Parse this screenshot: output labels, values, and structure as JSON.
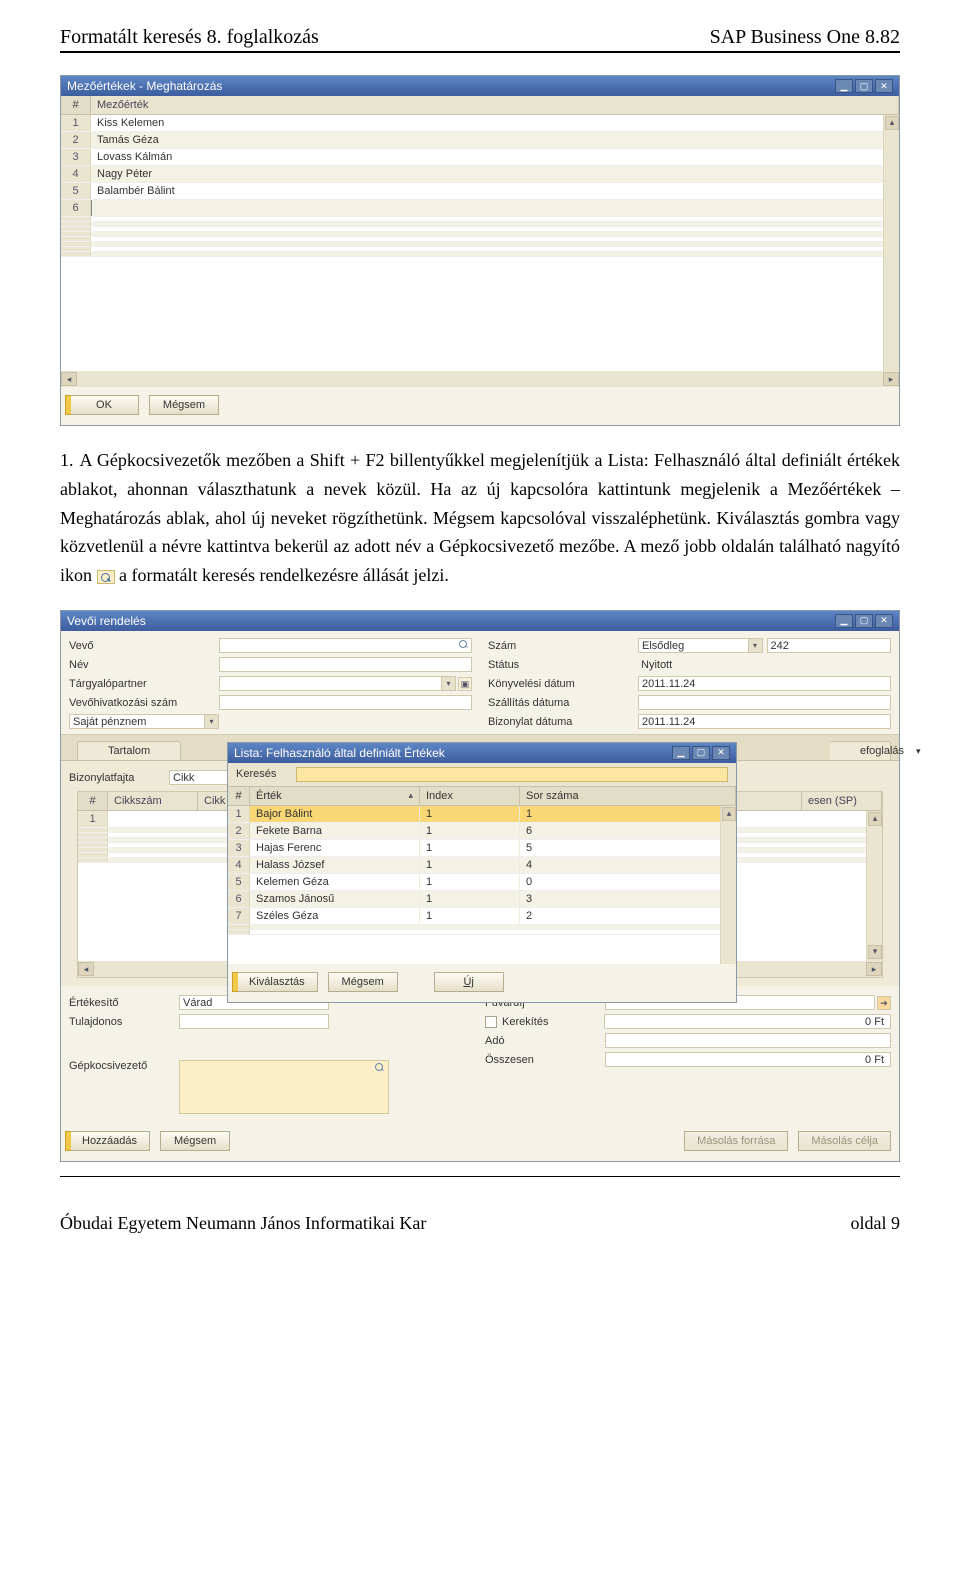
{
  "header": {
    "left": "Formatált keresés 8. foglalkozás",
    "right": "SAP Business One 8.82"
  },
  "win1": {
    "title": "Mezőértékek - Meghatározás",
    "col_num": "#",
    "col_val": "Mezőérték",
    "rows": [
      "Kiss Kelemen",
      "Tamás Géza",
      "Lovass Kálmán",
      "Nagy Péter",
      "Balambér Bálint",
      ""
    ],
    "ok": "OK",
    "cancel": "Mégsem"
  },
  "para": {
    "num": "1.",
    "text1": "A Gépkocsivezetők mezőben a Shift + F2 billentyűkkel megjelenítjük a Lista: Felhasználó által definiált értékek ablakot, ahonnan választhatunk a nevek közül. Ha az új kapcsolóra kattintunk megjelenik a Mezőértékek – Meghatározás ablak, ahol új neveket rögzíthetünk. Mégsem kapcsolóval visszaléphetünk. Kiválasztás gombra vagy közvetlenül a névre kattintva bekerül az adott név a Gépkocsivezető mezőbe. A mező jobb oldalán található nagyító ikon",
    "text2": "a formatált keresés rendelkezésre állását jelzi."
  },
  "win2": {
    "title": "Vevői rendelés",
    "left_labels": {
      "vevo": "Vevő",
      "nev": "Név",
      "tp": "Tárgyalópartner",
      "vhs": "Vevőhivatkozási szám",
      "pn": "Saját pénznem"
    },
    "right_labels": {
      "szam": "Szám",
      "szam_type": "Elsődleg",
      "szam_val": "242",
      "status": "Státus",
      "status_val": "Nyitott",
      "kd": "Könyvelési dátum",
      "kd_val": "2011.11.24",
      "sd": "Szállítás dátuma",
      "bd": "Bizonylat dátuma",
      "bd_val": "2011.11.24"
    },
    "tab1": "Tartalom",
    "tab2_partial": "efoglalás",
    "grid": {
      "c1": "Bizonylatfajta",
      "c1v": "Cikk",
      "h_num": "#",
      "h1": "Cikkszám",
      "h2": "Cikk leírá",
      "h3_partial": "esen (SP)"
    },
    "lower_left": {
      "ert": "Értékesítő",
      "ert_v": "Várad",
      "tul": "Tulajdonos",
      "gep": "Gépkocsivezető"
    },
    "lower_right": {
      "fuv": "Fuvardíj",
      "ker": "Kerekítés",
      "ker_v": "0 Ft",
      "ado": "Adó",
      "ossz": "Összesen",
      "ossz_v": "0 Ft"
    },
    "btns": {
      "add": "Hozzáadás",
      "cancel": "Mégsem",
      "copy_src": "Másolás forrása",
      "copy_tgt": "Másolás célja"
    }
  },
  "overlay": {
    "title": "Lista: Felhasználó által definiált Értékek",
    "search": "Keresés",
    "h_num": "#",
    "h1": "Érték",
    "h2": "Index",
    "h3": "Sor száma",
    "rows": [
      {
        "n": "1",
        "v": "Bajor Bálint",
        "i": "1",
        "s": "1"
      },
      {
        "n": "2",
        "v": "Fekete Barna",
        "i": "1",
        "s": "6"
      },
      {
        "n": "3",
        "v": "Hajas Ferenc",
        "i": "1",
        "s": "5"
      },
      {
        "n": "4",
        "v": "Halass József",
        "i": "1",
        "s": "4"
      },
      {
        "n": "5",
        "v": "Kelemen Géza",
        "i": "1",
        "s": "0"
      },
      {
        "n": "6",
        "v": "Szamos Jánosű",
        "i": "1",
        "s": "3"
      },
      {
        "n": "7",
        "v": "Széles Géza",
        "i": "1",
        "s": "2"
      }
    ],
    "btns": {
      "sel": "Kiválasztás",
      "cancel": "Mégsem",
      "new": "Új"
    }
  },
  "footer": {
    "left": "Óbudai Egyetem Neumann János Informatikai Kar",
    "right": "oldal 9"
  }
}
